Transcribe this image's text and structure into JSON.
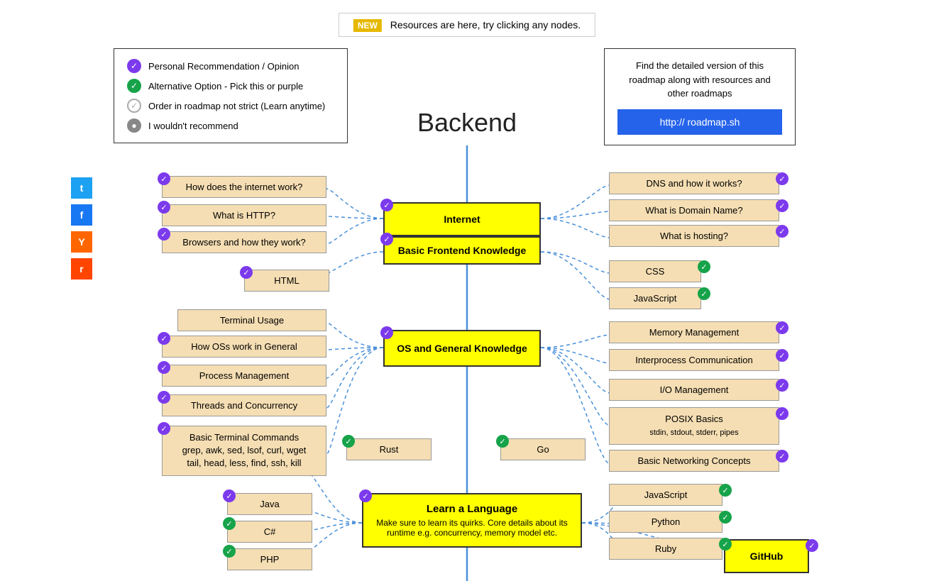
{
  "banner": {
    "new_label": "NEW",
    "text": "Resources are here, try clicking any nodes."
  },
  "legend": {
    "items": [
      {
        "icon": "purple-check",
        "label": "Personal Recommendation / Opinion"
      },
      {
        "icon": "green-check",
        "label": "Alternative Option - Pick this or purple"
      },
      {
        "icon": "gray-outline-check",
        "label": "Order in roadmap not strict (Learn anytime)"
      },
      {
        "icon": "gray-dot",
        "label": "I wouldn't recommend"
      }
    ]
  },
  "info_box": {
    "text": "Find the detailed version of this roadmap along with resources and other roadmaps",
    "link_label": "http:// roadmap.sh"
  },
  "title": "Backend",
  "social": {
    "items": [
      {
        "name": "twitter",
        "label": "t"
      },
      {
        "name": "facebook",
        "label": "f"
      },
      {
        "name": "hackernews",
        "label": "Y"
      },
      {
        "name": "reddit",
        "label": "r"
      }
    ]
  },
  "nodes": {
    "internet": {
      "label": "Internet"
    },
    "basic_frontend": {
      "label": "Basic Frontend Knowledge"
    },
    "os_general": {
      "label": "OS and General Knowledge"
    },
    "learn_language": {
      "label": "Learn a Language",
      "sublabel": "Make sure to learn its quirks. Core details about its runtime e.g. concurrency, memory model etc."
    },
    "left_items": [
      {
        "label": "How does the internet work?",
        "check": "purple"
      },
      {
        "label": "What is HTTP?",
        "check": "purple"
      },
      {
        "label": "Browsers and how they work?",
        "check": "purple"
      },
      {
        "label": "HTML",
        "check": "purple"
      },
      {
        "label": "Terminal Usage",
        "check": null
      },
      {
        "label": "How OSs work in General",
        "check": "purple"
      },
      {
        "label": "Process Management",
        "check": "purple"
      },
      {
        "label": "Threads and Concurrency",
        "check": "purple"
      },
      {
        "label": "Basic Terminal Commands\ngrep, awk, sed, lsof, curl, wget\ntail, head, less, find, ssh, kill",
        "check": "purple"
      },
      {
        "label": "Rust",
        "check": "green"
      },
      {
        "label": "Go",
        "check": "green"
      },
      {
        "label": "Java",
        "check": "purple"
      },
      {
        "label": "C#",
        "check": "green"
      },
      {
        "label": "PHP",
        "check": "green"
      }
    ],
    "right_items": [
      {
        "label": "DNS and how it works?",
        "check": "purple"
      },
      {
        "label": "What is Domain Name?",
        "check": "purple"
      },
      {
        "label": "What is hosting?",
        "check": "purple"
      },
      {
        "label": "CSS",
        "check": "green"
      },
      {
        "label": "JavaScript",
        "check": "green"
      },
      {
        "label": "Memory Management",
        "check": "purple"
      },
      {
        "label": "Interprocess Communication",
        "check": "purple"
      },
      {
        "label": "I/O Management",
        "check": "purple"
      },
      {
        "label": "POSIX Basics\nstdin, stdout, stderr, pipes",
        "check": "purple"
      },
      {
        "label": "Basic Networking Concepts",
        "check": "purple"
      },
      {
        "label": "JavaScript",
        "check": "green"
      },
      {
        "label": "Python",
        "check": "green"
      },
      {
        "label": "Ruby",
        "check": "green"
      },
      {
        "label": "GitHub",
        "check": "purple"
      }
    ]
  }
}
